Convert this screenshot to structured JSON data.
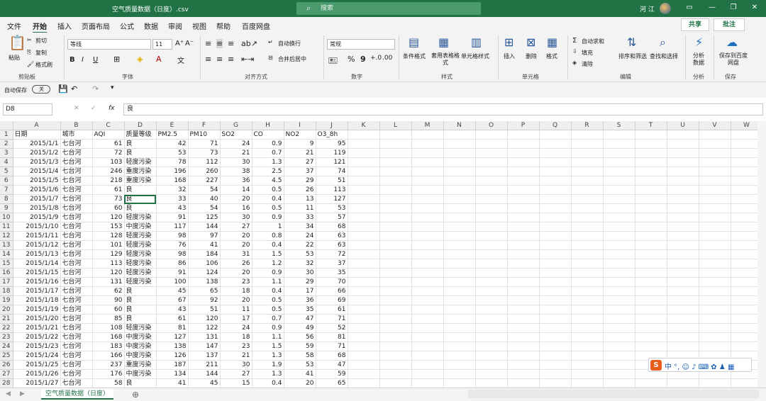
{
  "window": {
    "title": "空气质量数据（日度）.csv",
    "search_placeholder": "搜索",
    "user": "河 江"
  },
  "menu": {
    "tabs": [
      "文件",
      "开始",
      "插入",
      "页面布局",
      "公式",
      "数据",
      "审阅",
      "视图",
      "帮助",
      "百度网盘"
    ],
    "active": "开始",
    "share": "共享",
    "comment": "批注"
  },
  "ribbon": {
    "clipboard": {
      "paste": "粘贴",
      "cut": "剪切",
      "copy": "复制",
      "format_painter": "格式刷",
      "group": "剪贴板"
    },
    "font": {
      "name": "等线",
      "size": "11",
      "group": "字体",
      "grow": "A⁺",
      "shrink": "A⁻",
      "bold": "B",
      "italic": "I",
      "underline": "U"
    },
    "align": {
      "wrap": "自动换行",
      "merge": "合并后居中",
      "group": "对齐方式"
    },
    "number": {
      "format": "常规",
      "group": "数字",
      "percent": "%",
      "comma": "9"
    },
    "styles": {
      "cond": "条件格式",
      "table": "套用表格格式",
      "cell": "单元格样式",
      "group": "样式"
    },
    "cells": {
      "insert": "插入",
      "delete": "删除",
      "format": "格式",
      "group": "单元格"
    },
    "edit": {
      "autosum": "自动求和",
      "fill": "填充",
      "clear": "清除",
      "sort": "排序和筛选",
      "find": "查找和选择",
      "group": "编辑"
    },
    "analysis": {
      "analyze": "分析数据",
      "group": "分析"
    },
    "save": {
      "label": "保存到百度网盘",
      "group": "保存"
    }
  },
  "quick": {
    "autosave": "自动保存",
    "toggle": "关"
  },
  "formula_bar": {
    "cell": "D8",
    "fx": "fx",
    "value": "良"
  },
  "columns": [
    "A",
    "B",
    "C",
    "D",
    "E",
    "F",
    "G",
    "H",
    "I",
    "J",
    "K",
    "L",
    "M",
    "N",
    "O",
    "P",
    "Q",
    "R",
    "S",
    "T",
    "U",
    "V",
    "W"
  ],
  "headers": [
    "日期",
    "城市",
    "AQI",
    "质量等级",
    "PM2.5",
    "PM10",
    "SO2",
    "CO",
    "NO2",
    "O3_8h"
  ],
  "rows": [
    [
      "2015/1/1",
      "七台河",
      "61",
      "良",
      "42",
      "71",
      "24",
      "0.9",
      "9",
      "95"
    ],
    [
      "2015/1/2",
      "七台河",
      "72",
      "良",
      "53",
      "73",
      "21",
      "0.7",
      "21",
      "119"
    ],
    [
      "2015/1/3",
      "七台河",
      "103",
      "轻度污染",
      "78",
      "112",
      "30",
      "1.3",
      "27",
      "121"
    ],
    [
      "2015/1/4",
      "七台河",
      "246",
      "重度污染",
      "196",
      "260",
      "38",
      "2.5",
      "37",
      "74"
    ],
    [
      "2015/1/5",
      "七台河",
      "218",
      "重度污染",
      "168",
      "227",
      "36",
      "4.5",
      "29",
      "51"
    ],
    [
      "2015/1/6",
      "七台河",
      "61",
      "良",
      "32",
      "54",
      "14",
      "0.5",
      "26",
      "113"
    ],
    [
      "2015/1/7",
      "七台河",
      "73",
      "良",
      "33",
      "40",
      "20",
      "0.4",
      "13",
      "127"
    ],
    [
      "2015/1/8",
      "七台河",
      "60",
      "良",
      "43",
      "54",
      "16",
      "0.5",
      "11",
      "53"
    ],
    [
      "2015/1/9",
      "七台河",
      "120",
      "轻度污染",
      "91",
      "125",
      "30",
      "0.9",
      "33",
      "57"
    ],
    [
      "2015/1/10",
      "七台河",
      "153",
      "中度污染",
      "117",
      "144",
      "27",
      "1",
      "34",
      "68"
    ],
    [
      "2015/1/11",
      "七台河",
      "128",
      "轻度污染",
      "98",
      "97",
      "20",
      "0.8",
      "24",
      "63"
    ],
    [
      "2015/1/12",
      "七台河",
      "101",
      "轻度污染",
      "76",
      "41",
      "20",
      "0.4",
      "22",
      "63"
    ],
    [
      "2015/1/13",
      "七台河",
      "129",
      "轻度污染",
      "98",
      "184",
      "31",
      "1.5",
      "53",
      "72"
    ],
    [
      "2015/1/14",
      "七台河",
      "113",
      "轻度污染",
      "86",
      "106",
      "26",
      "1.2",
      "32",
      "37"
    ],
    [
      "2015/1/15",
      "七台河",
      "120",
      "轻度污染",
      "91",
      "124",
      "20",
      "0.9",
      "30",
      "35"
    ],
    [
      "2015/1/16",
      "七台河",
      "131",
      "轻度污染",
      "100",
      "138",
      "23",
      "1.1",
      "29",
      "70"
    ],
    [
      "2015/1/17",
      "七台河",
      "62",
      "良",
      "45",
      "65",
      "18",
      "0.4",
      "17",
      "66"
    ],
    [
      "2015/1/18",
      "七台河",
      "90",
      "良",
      "67",
      "92",
      "20",
      "0.5",
      "36",
      "69"
    ],
    [
      "2015/1/19",
      "七台河",
      "60",
      "良",
      "43",
      "51",
      "11",
      "0.5",
      "35",
      "61"
    ],
    [
      "2015/1/20",
      "七台河",
      "85",
      "良",
      "61",
      "120",
      "17",
      "0.7",
      "47",
      "71"
    ],
    [
      "2015/1/21",
      "七台河",
      "108",
      "轻度污染",
      "81",
      "122",
      "24",
      "0.9",
      "49",
      "52"
    ],
    [
      "2015/1/22",
      "七台河",
      "168",
      "中度污染",
      "127",
      "131",
      "18",
      "1.1",
      "56",
      "81"
    ],
    [
      "2015/1/23",
      "七台河",
      "183",
      "中度污染",
      "138",
      "147",
      "23",
      "1.5",
      "59",
      "71"
    ],
    [
      "2015/1/24",
      "七台河",
      "166",
      "中度污染",
      "126",
      "137",
      "21",
      "1.3",
      "58",
      "68"
    ],
    [
      "2015/1/25",
      "七台河",
      "237",
      "重度污染",
      "187",
      "211",
      "30",
      "1.9",
      "53",
      "47"
    ],
    [
      "2015/1/26",
      "七台河",
      "176",
      "中度污染",
      "134",
      "144",
      "27",
      "1.3",
      "41",
      "59"
    ],
    [
      "2015/1/27",
      "七台河",
      "58",
      "良",
      "41",
      "45",
      "15",
      "0.4",
      "20",
      "65"
    ]
  ],
  "sheet_tab": "空气质量数据（日度）",
  "add_sheet": "⊕"
}
